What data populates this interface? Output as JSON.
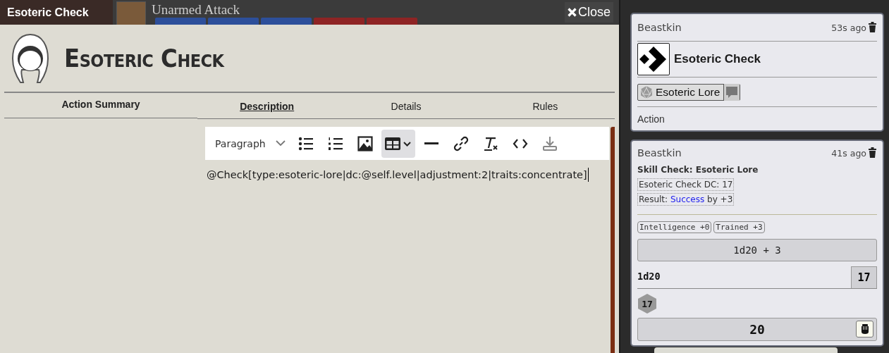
{
  "background_sheet": {
    "item_name": "Unarmed Attack",
    "tags": [
      {
        "color": "#2d4f9a"
      },
      {
        "color": "#2d4f9a"
      },
      {
        "color": "#2d4f9a"
      },
      {
        "color": "#8e2424"
      },
      {
        "color": "#8e2424"
      }
    ]
  },
  "window": {
    "title": "Esoteric Check",
    "close_label": "Close"
  },
  "sheet": {
    "title": "Esoteric Check",
    "summary_tab": "Action Summary",
    "tabs": [
      {
        "label": "Description",
        "selected": true
      },
      {
        "label": "Details",
        "selected": false
      },
      {
        "label": "Rules",
        "selected": false
      }
    ],
    "editor": {
      "format_select": "Paragraph",
      "toolbar": [
        {
          "kind": "bullet-list",
          "active": false
        },
        {
          "kind": "numbered-list",
          "active": false
        },
        {
          "kind": "image",
          "active": false
        },
        {
          "kind": "table",
          "active": true
        },
        {
          "kind": "rule",
          "active": false
        },
        {
          "kind": "link",
          "active": false
        },
        {
          "kind": "clear-format",
          "active": false
        },
        {
          "kind": "code",
          "active": false
        },
        {
          "kind": "save",
          "active": false
        }
      ],
      "content": "@Check[type:esoteric-lore|dc:@self.level|adjustment:2|traits:concentrate]"
    }
  },
  "chat": {
    "messages": [
      {
        "kind": "action",
        "speaker": "Beastkin",
        "time": "53s ago",
        "title": "Esoteric Check",
        "skill": "Esoteric Lore",
        "footer": "Action"
      },
      {
        "kind": "check",
        "speaker": "Beastkin",
        "time": "41s ago",
        "heading": "Skill Check: Esoteric Lore",
        "dc_line": "Esoteric Check DC: 17",
        "result_prefix": "Result:",
        "result_word": "Success",
        "result_suffix": "by +3",
        "modifiers": [
          "Intelligence +0",
          "Trained +3"
        ],
        "formula": "1d20 + 3",
        "die_label": "1d20",
        "die_total": "17",
        "dice": [
          "17"
        ],
        "total": "20"
      }
    ]
  }
}
